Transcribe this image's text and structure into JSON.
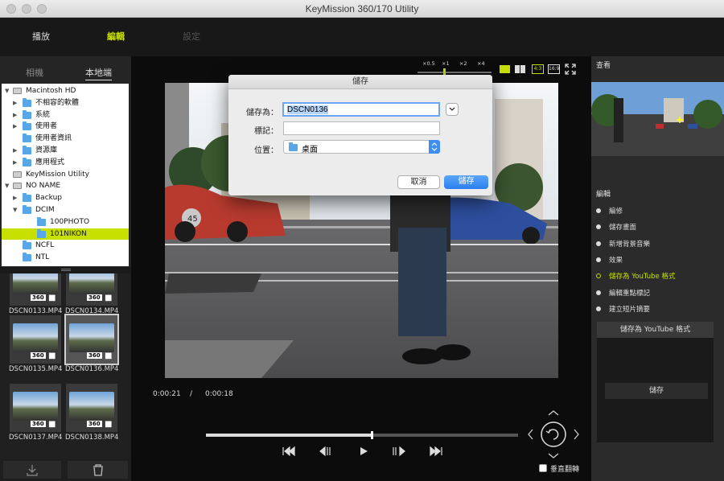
{
  "window": {
    "title": "KeyMission 360/170 Utility"
  },
  "menu": {
    "play": "播放",
    "edit": "編輯",
    "settings": "設定"
  },
  "source": {
    "camera": "相機",
    "local": "本地端"
  },
  "tree": [
    {
      "label": "Macintosh HD",
      "type": "disk",
      "level": 0,
      "expanded": true
    },
    {
      "label": "不相容的軟體",
      "type": "folder",
      "level": 1,
      "expanded": false
    },
    {
      "label": "系統",
      "type": "folder",
      "level": 1,
      "expanded": false
    },
    {
      "label": "使用者",
      "type": "folder",
      "level": 1,
      "expanded": false
    },
    {
      "label": "使用者資訊",
      "type": "folder",
      "level": 1,
      "expanded": null
    },
    {
      "label": "資源庫",
      "type": "folder",
      "level": 1,
      "expanded": false
    },
    {
      "label": "應用程式",
      "type": "folder",
      "level": 1,
      "expanded": false
    },
    {
      "label": "KeyMission Utility",
      "type": "disk",
      "level": 0,
      "expanded": null
    },
    {
      "label": "NO NAME",
      "type": "disk",
      "level": 0,
      "expanded": true
    },
    {
      "label": "Backup",
      "type": "folder",
      "level": 1,
      "expanded": false
    },
    {
      "label": "DCIM",
      "type": "folder",
      "level": 1,
      "expanded": true
    },
    {
      "label": "100PHOTO",
      "type": "folder",
      "level": 2,
      "expanded": null
    },
    {
      "label": "101NIKON",
      "type": "folder",
      "level": 2,
      "expanded": null,
      "selected": true
    },
    {
      "label": "NCFL",
      "type": "folder",
      "level": 1,
      "expanded": null
    },
    {
      "label": "NTL",
      "type": "folder",
      "level": 1,
      "expanded": null
    }
  ],
  "thumbnails": [
    {
      "name": "DSCN0133.MP4",
      "badge": "360"
    },
    {
      "name": "DSCN0134.MP4",
      "badge": "360"
    },
    {
      "name": "DSCN0135.MP4",
      "badge": "360"
    },
    {
      "name": "DSCN0136.MP4",
      "badge": "360",
      "selected": true
    },
    {
      "name": "DSCN0137.MP4",
      "badge": "360"
    },
    {
      "name": "DSCN0138.MP4",
      "badge": "360"
    }
  ],
  "zoom": {
    "levels": [
      "×0.5",
      "×1",
      "×2",
      "×4"
    ],
    "current": "×1"
  },
  "aspect": {
    "a": "4:3",
    "b": "16:9"
  },
  "time": {
    "current": "0:00:21",
    "separator": "/",
    "total": "0:00:18"
  },
  "playback": {
    "progress": 0.533
  },
  "flip": {
    "label": "垂直翻轉",
    "checked": false
  },
  "right": {
    "view_title": "查看",
    "edit_title": "編輯",
    "items": [
      {
        "label": "編修",
        "active": false
      },
      {
        "label": "儲存畫面",
        "active": false
      },
      {
        "label": "新增背景音樂",
        "active": false
      },
      {
        "label": "效果",
        "active": false
      },
      {
        "label": "儲存為 YouTube 格式",
        "active": true
      },
      {
        "label": "編輯重點標記",
        "active": false
      },
      {
        "label": "建立短片摘要",
        "active": false
      }
    ],
    "panel_title": "儲存為 YouTube 格式",
    "save_button": "儲存"
  },
  "dialog": {
    "title": "儲存",
    "save_as_label": "儲存為：",
    "save_as_value": "DSCN0136",
    "tags_label": "標記：",
    "tags_value": "",
    "where_label": "位置：",
    "where_value": "桌面",
    "cancel": "取消",
    "save": "儲存"
  },
  "colors": {
    "accent": "#c8e000",
    "dialog_primary": "#3d8ef0"
  }
}
